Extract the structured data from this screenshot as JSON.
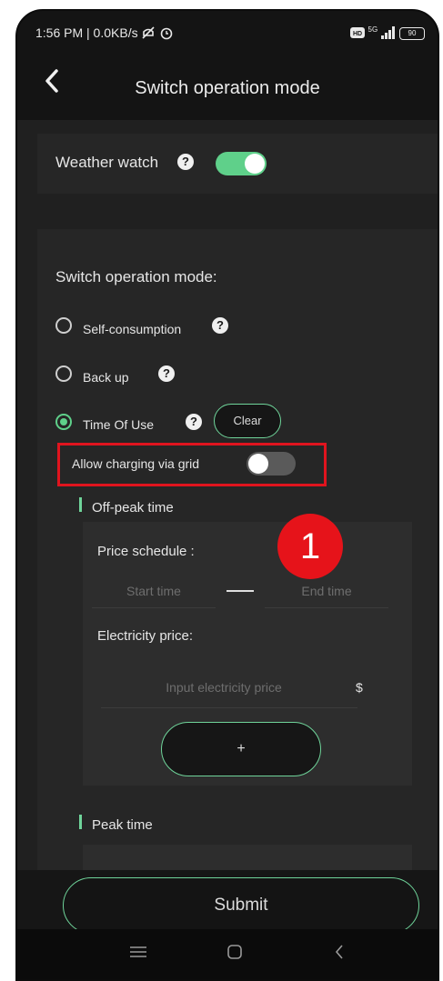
{
  "status_bar": {
    "left_text": "1:56 PM | 0.0KB/s",
    "network": "5G",
    "battery": "90"
  },
  "header": {
    "title": "Switch operation mode"
  },
  "weather_watch": {
    "label": "Weather watch",
    "enabled": true
  },
  "mode_section": {
    "heading": "Switch operation mode:",
    "options": [
      {
        "label": "Self-consumption",
        "selected": false
      },
      {
        "label": "Back up",
        "selected": false
      },
      {
        "label": "Time Of Use",
        "selected": true
      }
    ],
    "clear_label": "Clear",
    "allow_grid_label": "Allow charging via grid",
    "allow_grid_enabled": false
  },
  "off_peak": {
    "heading": "Off-peak time",
    "price_schedule_label": "Price schedule :",
    "start_placeholder": "Start time",
    "end_placeholder": "End time",
    "electricity_price_label": "Electricity price:",
    "price_placeholder": "Input electricity price",
    "currency": "$",
    "add_label": "+"
  },
  "peak": {
    "heading": "Peak time"
  },
  "annotation": {
    "badge_number": "1",
    "highlight_color": "#e0141e"
  },
  "submit_label": "Submit",
  "colors": {
    "accent": "#5fd08a",
    "background": "#141414"
  }
}
